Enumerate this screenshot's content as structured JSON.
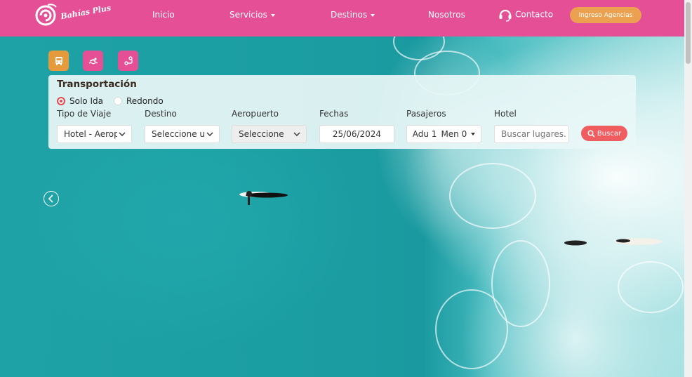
{
  "brand": {
    "name": "Bahías Plus",
    "nav_color": "#e54f95"
  },
  "nav": {
    "items": [
      {
        "label": "Inicio"
      },
      {
        "label": "Servicios",
        "dropdown": true
      },
      {
        "label": "Destinos",
        "dropdown": true
      },
      {
        "label": "Nosotros"
      },
      {
        "label": "Contacto",
        "icon": "headset-icon"
      }
    ],
    "agency_button": "Ingreso Agencias"
  },
  "service_tabs": [
    {
      "icon": "bus-icon",
      "color": "#e59a3b",
      "active": true
    },
    {
      "icon": "swim-icon",
      "color": "#e54f95"
    },
    {
      "icon": "tour-icon",
      "color": "#e54f95"
    }
  ],
  "search_panel": {
    "title": "Transportación",
    "trip_options": [
      {
        "label": "Solo Ida",
        "selected": true
      },
      {
        "label": "Redondo",
        "selected": false
      }
    ],
    "fields": {
      "trip_type": {
        "label": "Tipo de Viaje",
        "value": "Hotel - Aeropuerto"
      },
      "destination": {
        "label": "Destino",
        "value": "Seleccione un destino"
      },
      "airport": {
        "label": "Aeropuerto",
        "value": "Seleccione"
      },
      "dates": {
        "label": "Fechas",
        "value": "25/06/2024"
      },
      "passengers": {
        "label": "Pasajeros",
        "adults": "Adu 1",
        "minors": "Men 0"
      },
      "hotel": {
        "label": "Hotel",
        "placeholder": "Buscar lugares..."
      }
    },
    "search_button": "Buscar"
  }
}
